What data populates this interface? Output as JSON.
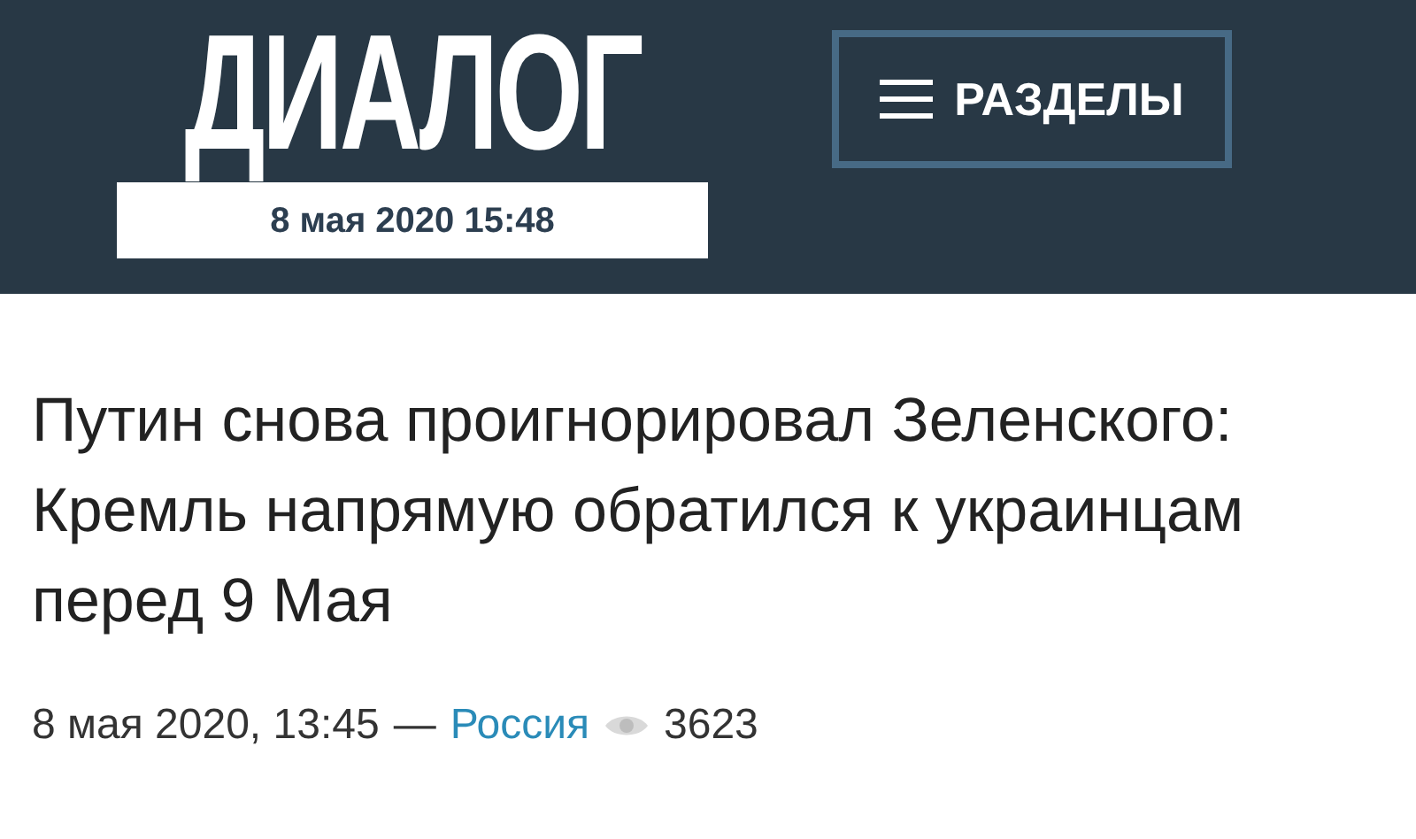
{
  "header": {
    "logo": "ДИАЛОГ",
    "current_date": "8 мая 2020 15:48",
    "menu_button": "РАЗДЕЛЫ"
  },
  "article": {
    "title": "Путин снова проигнорировал Зеленского: Кремль напрямую обратился к украинцам перед 9 Мая",
    "published": "8 мая 2020, 13:45",
    "separator": "—",
    "category": "Россия",
    "views": "3623"
  }
}
